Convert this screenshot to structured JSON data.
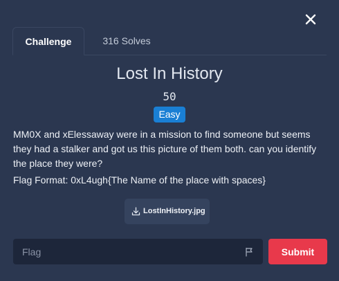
{
  "modal": {
    "close_icon": "close-icon"
  },
  "tabs": [
    {
      "label": "Challenge",
      "active": true
    },
    {
      "label": "316 Solves",
      "active": false
    }
  ],
  "challenge": {
    "title": "Lost In History",
    "points": "50",
    "difficulty": "Easy",
    "description": "MM0X and xElessaway were in a mission to find someone but seems they had a stalker and got us this picture of them both. can you identify the place they were?",
    "flag_format": "Flag Format: 0xL4ugh{The Name of the place with spaces}"
  },
  "file": {
    "name": "LostInHistory.jpg",
    "icon": "download-icon"
  },
  "flag_input": {
    "placeholder": "Flag",
    "value": "",
    "icon": "flag-icon"
  },
  "submit": {
    "label": "Submit"
  },
  "colors": {
    "background": "#2b3750",
    "badge": "#1a7fd4",
    "submit": "#e8394b",
    "input_bg": "#1d263a",
    "file_button_bg": "#35435e"
  }
}
